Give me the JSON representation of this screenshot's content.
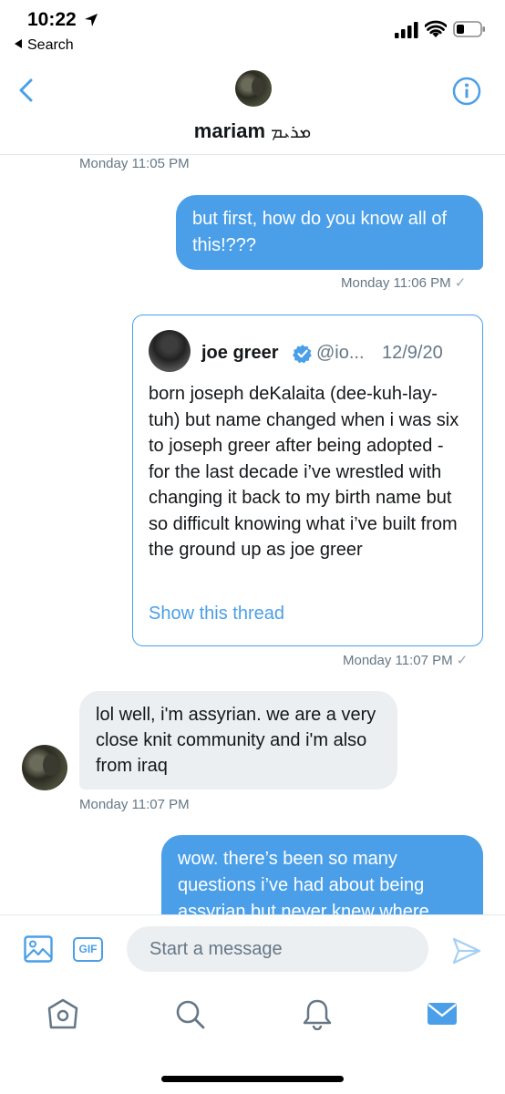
{
  "status_bar": {
    "time": "10:22",
    "back_label": "Search"
  },
  "header": {
    "name": "mariam",
    "name_script": "ܡܪܝܡ"
  },
  "conversation": {
    "messages": [
      {
        "timestamp": "Monday 11:05 PM"
      },
      {
        "text": "but first, how do you know all of this!???",
        "timestamp": "Monday 11:06 PM",
        "check": "✓"
      },
      {
        "tweet": {
          "name": "joe greer",
          "handle": "@io...",
          "date": "12/9/20",
          "body": "born joseph deKalaita (dee-kuh-lay-tuh) but name changed when i was six to joseph greer after being adopted - for the last decade i’ve wrestled with changing it back to my birth name but so difficult knowing what i’ve built from the ground up as joe greer",
          "thread_link": "Show this thread"
        },
        "timestamp": "Monday 11:07 PM",
        "check": "✓"
      },
      {
        "text": "lol well, i'm assyrian. we are a very close knit community and i'm also from iraq",
        "timestamp": "Monday 11:07 PM"
      },
      {
        "text": "wow. there’s been so many questions i’ve had about being assyrian but never knew where"
      }
    ]
  },
  "composer": {
    "placeholder": "Start a message",
    "gif_label": "GIF"
  },
  "colors": {
    "accent": "#4a9fe8",
    "incoming_bubble": "#eceff1",
    "muted_text": "#657786"
  }
}
